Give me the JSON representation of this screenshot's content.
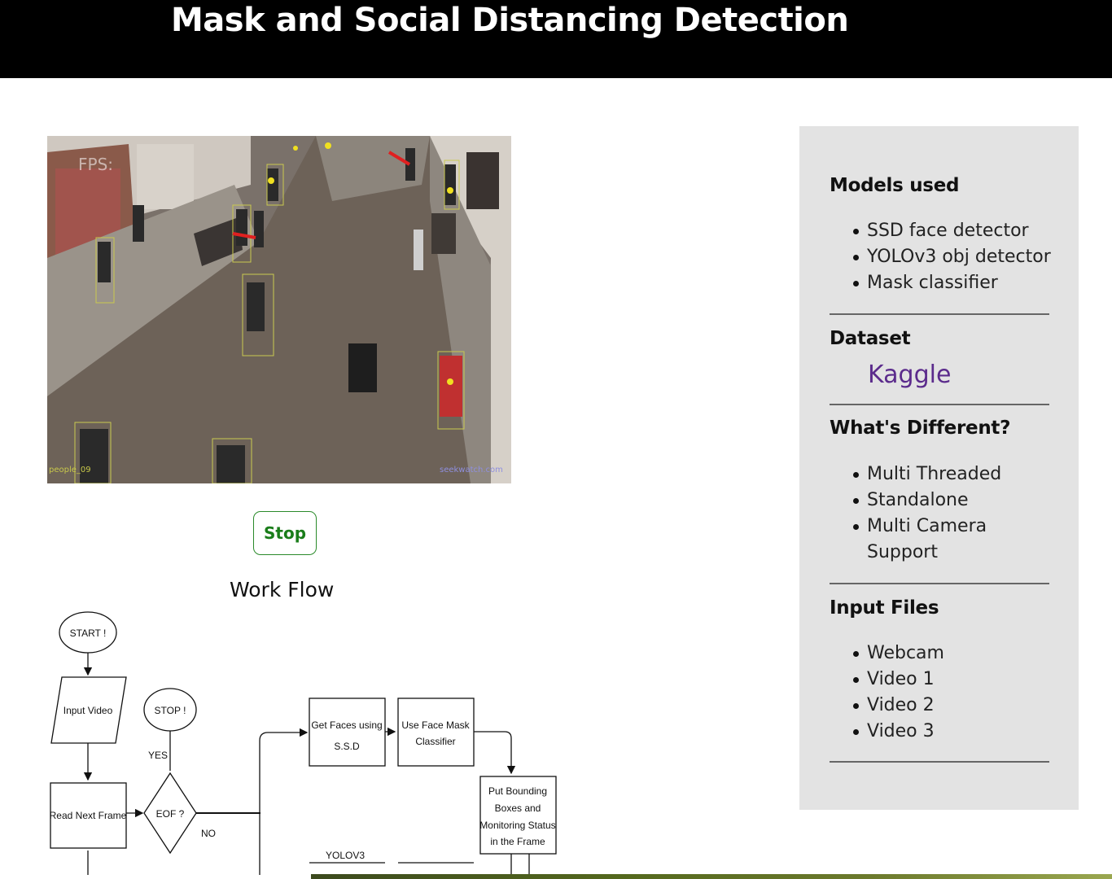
{
  "header": {
    "title": "Mask and Social Distancing Detection"
  },
  "video": {
    "fps_label": "FPS:",
    "watermark_left": "people_09",
    "watermark_right": "seekwatch.com"
  },
  "controls": {
    "stop_label": "Stop"
  },
  "workflow": {
    "title": "Work Flow",
    "nodes": {
      "start": "START !",
      "input_video": "Input Video",
      "stop": "STOP !",
      "yes": "YES",
      "read_next_frame": "Read Next Frame",
      "eof": "EOF ?",
      "no": "NO",
      "get_faces_1": "Get Faces using",
      "get_faces_2": "S.S.D",
      "face_mask_1": "Use Face Mask",
      "face_mask_2": "Classifier",
      "bbox_1": "Put Bounding",
      "bbox_2": "Boxes and",
      "bbox_3": "Monitoring Status",
      "bbox_4": "in the Frame",
      "yolo": "YOLOV3"
    }
  },
  "sidebar": {
    "models_heading": "Models used",
    "models": [
      "SSD face detector",
      "YOLOv3 obj detector",
      "Mask classifier"
    ],
    "dataset_heading": "Dataset",
    "dataset_link": "Kaggle",
    "different_heading": "What's Different?",
    "different": [
      "Multi Threaded",
      "Standalone",
      "Multi Camera Support"
    ],
    "input_heading": "Input Files",
    "inputs": [
      "Webcam",
      "Video 1",
      "Video 2",
      "Video 3"
    ],
    "link_color": "#5b2b8c"
  }
}
